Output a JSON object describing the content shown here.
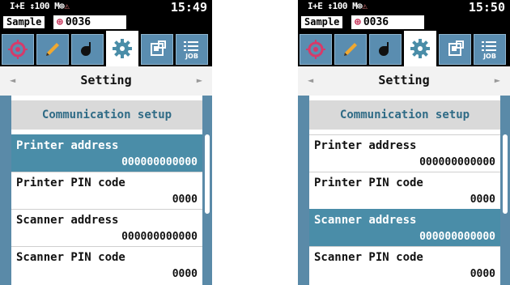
{
  "screens": [
    {
      "status_icons": "I+E ↕100 M⊕",
      "warn_icon": "⚠",
      "clock": "15:49",
      "sample_label": "Sample",
      "sample_number": "0036",
      "tabs": [
        {
          "icon": "target-icon"
        },
        {
          "icon": "pencil-icon"
        },
        {
          "icon": "sample-icon"
        },
        {
          "icon": "gear-icon",
          "active": true
        },
        {
          "icon": "data-icon"
        },
        {
          "icon": "job-icon",
          "label": "JOB"
        }
      ],
      "nav_title": "Setting",
      "section_header": "Communication setup",
      "rows": [
        {
          "label": "Printer address",
          "value": "000000000000",
          "selected": true
        },
        {
          "label": "Printer PIN code",
          "value": "0000",
          "selected": false
        },
        {
          "label": "Scanner address",
          "value": "000000000000",
          "selected": false
        },
        {
          "label": "Scanner PIN code",
          "value": "0000",
          "selected": false
        }
      ]
    },
    {
      "status_icons": "I+E ↕100 M⊕",
      "warn_icon": "⚠",
      "clock": "15:50",
      "sample_label": "Sample",
      "sample_number": "0036",
      "tabs": [
        {
          "icon": "target-icon"
        },
        {
          "icon": "pencil-icon"
        },
        {
          "icon": "sample-icon"
        },
        {
          "icon": "gear-icon",
          "active": true
        },
        {
          "icon": "data-icon"
        },
        {
          "icon": "job-icon",
          "label": "JOB"
        }
      ],
      "nav_title": "Setting",
      "section_header": "Communication setup",
      "rows": [
        {
          "label": "Printer address",
          "value": "000000000000",
          "selected": false
        },
        {
          "label": "Printer PIN code",
          "value": "0000",
          "selected": false
        },
        {
          "label": "Scanner address",
          "value": "000000000000",
          "selected": true
        },
        {
          "label": "Scanner PIN code",
          "value": "0000",
          "selected": false
        }
      ]
    }
  ],
  "nav_prev_icon": "◄",
  "nav_next_icon": "►",
  "colors": {
    "accent": "#4a8da8",
    "tab_background": "#5a8db0",
    "header_text": "#2f6b86",
    "sample_icon": "#c3204a"
  }
}
